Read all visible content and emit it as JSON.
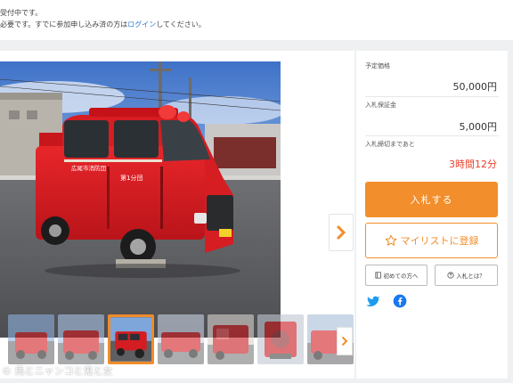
{
  "notice": {
    "line1": "受付中です。",
    "line2_before": "必要です。すでに参加申し込み済の方は",
    "line2_link": "ログイン",
    "line2_after": "してください。"
  },
  "gallery": {
    "main_image": "red fire truck photo",
    "truck_side_text": "広尾市消防団",
    "truck_unit_text": "第1分団",
    "thumbnails": [
      {
        "name": "fire-truck-front-view"
      },
      {
        "name": "fire-truck-angle-view"
      },
      {
        "name": "fire-truck-side-view",
        "active": true
      },
      {
        "name": "fire-truck-rear-view"
      },
      {
        "name": "fire-truck-open-door"
      },
      {
        "name": "fire-truck-equipment"
      },
      {
        "name": "fire-truck-other"
      }
    ]
  },
  "panel": {
    "planned_price_label": "予定価格",
    "planned_price_value": "50,000円",
    "deposit_label": "入札保証金",
    "deposit_value": "5,000円",
    "deadline_label": "入札締切まであと",
    "deadline_value": "3時間12分",
    "bid_button": "入札する",
    "mylist_button": "マイリストに登録",
    "first_time_button": "初めての方へ",
    "what_is_bid_button": "入札とは？"
  },
  "watermark": "© 馬とニャンコと鬼と女",
  "colors": {
    "accent": "#f28e2b",
    "deadline": "#e8402b",
    "link": "#2a7ad8",
    "twitter": "#1d9bf0",
    "facebook": "#1877f2"
  }
}
